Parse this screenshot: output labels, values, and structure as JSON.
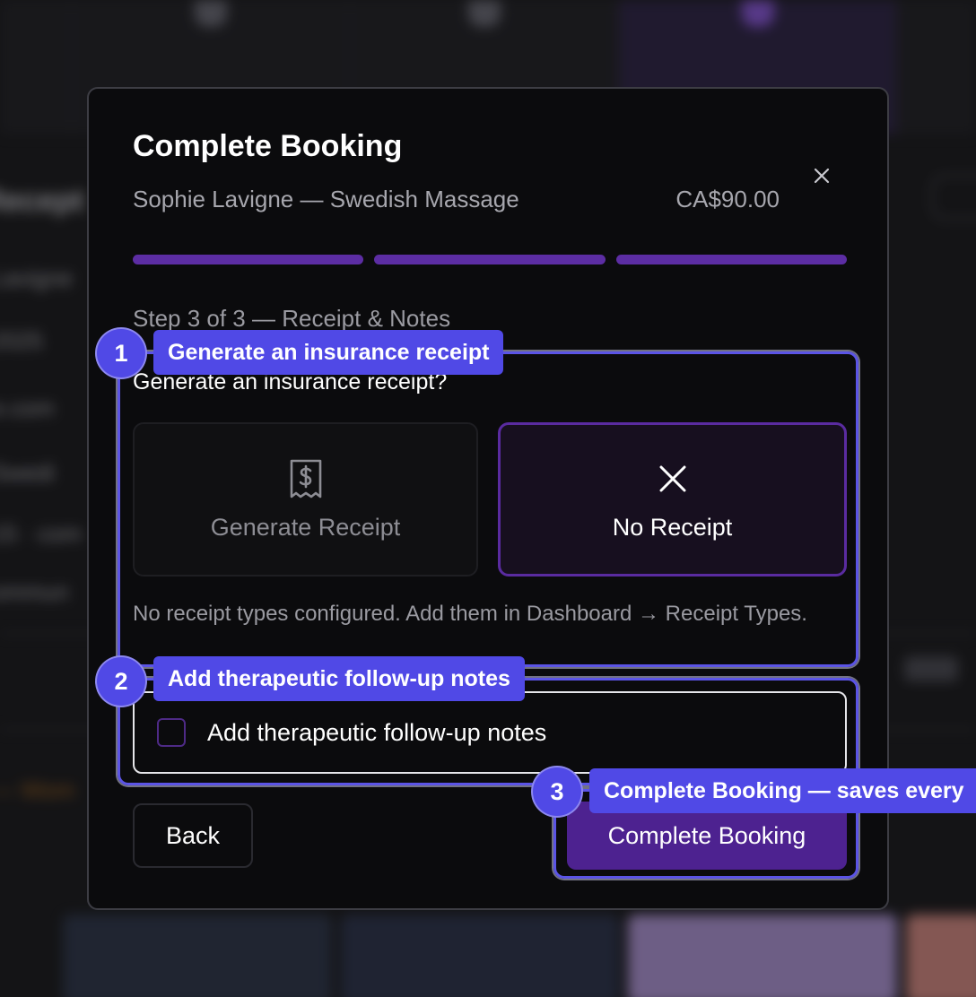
{
  "modal": {
    "title": "Complete Booking",
    "subtitle": "Sophie Lavigne — Swedish Massage",
    "price": "CA$90.00",
    "progress": {
      "current_step": 3,
      "total_steps": 3
    },
    "step_label": "Step 3 of 3 — Receipt & Notes",
    "receipt_question": "Generate an insurance receipt?",
    "options": {
      "generate": {
        "label": "Generate Receipt",
        "icon": "receipt-dollar-icon"
      },
      "no_receipt": {
        "label": "No Receipt",
        "icon": "x-icon",
        "selected": true
      }
    },
    "hint": "No receipt types configured. Add them in Dashboard → Receipt Types.",
    "notes_checkbox": {
      "label": "Add therapeutic follow-up notes",
      "checked": false
    },
    "back_label": "Back",
    "complete_label": "Complete Booking"
  },
  "annotations": [
    {
      "number": "1",
      "text": "Generate an insurance receipt"
    },
    {
      "number": "2",
      "text": "Add therapeutic follow-up notes"
    },
    {
      "number": "3",
      "text": "Complete Booking — saves every"
    }
  ],
  "colors": {
    "accent": "#5c2da3",
    "annotation": "#5049e6",
    "modal_bg": "#0b0b0d"
  }
}
